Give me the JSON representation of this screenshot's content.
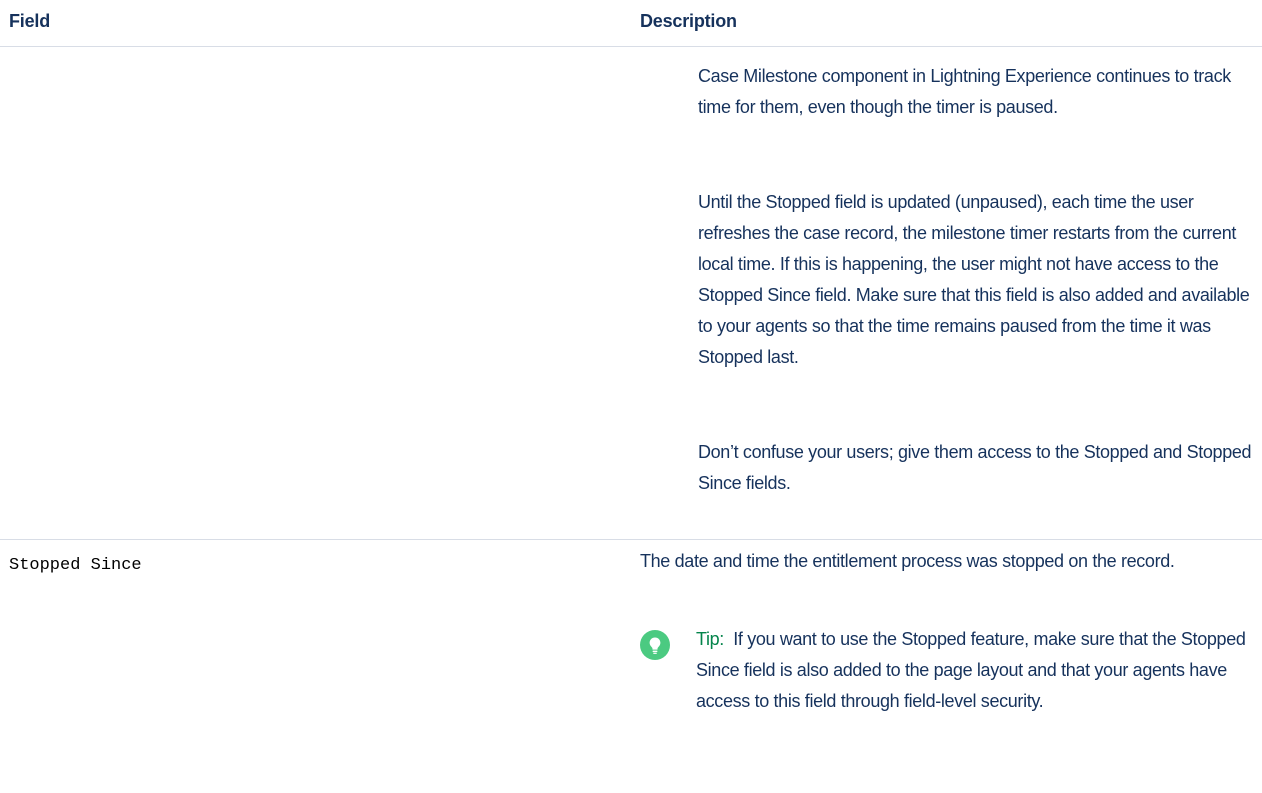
{
  "table": {
    "headers": {
      "field": "Field",
      "description": "Description"
    },
    "rows": [
      {
        "field": "",
        "paragraphs": [
          "Case Milestone component in Lightning Experience continues to track time for them, even though the timer is paused.",
          "Until the Stopped field is updated (unpaused), each time the user refreshes the case record, the milestone timer restarts from the current local time. If this is happening, the user might not have access to the Stopped Since field. Make sure that this field is also added and available to your agents so that the time remains paused from the time it was Stopped last.",
          "Don’t confuse your users; give them access to the Stopped and Stopped Since fields."
        ]
      },
      {
        "field": "Stopped Since",
        "paragraphs": [
          "The date and time the entitlement process was stopped on the record."
        ],
        "tip": {
          "icon": "lightbulb-icon",
          "label": "Tip:",
          "text": "If you want to use the Stopped feature, make sure that the Stopped Since field is also added to the page layout and that your agents have access to this field through field-level security.",
          "icon_color": "#4bca81",
          "label_color": "#04844b"
        }
      }
    ]
  }
}
